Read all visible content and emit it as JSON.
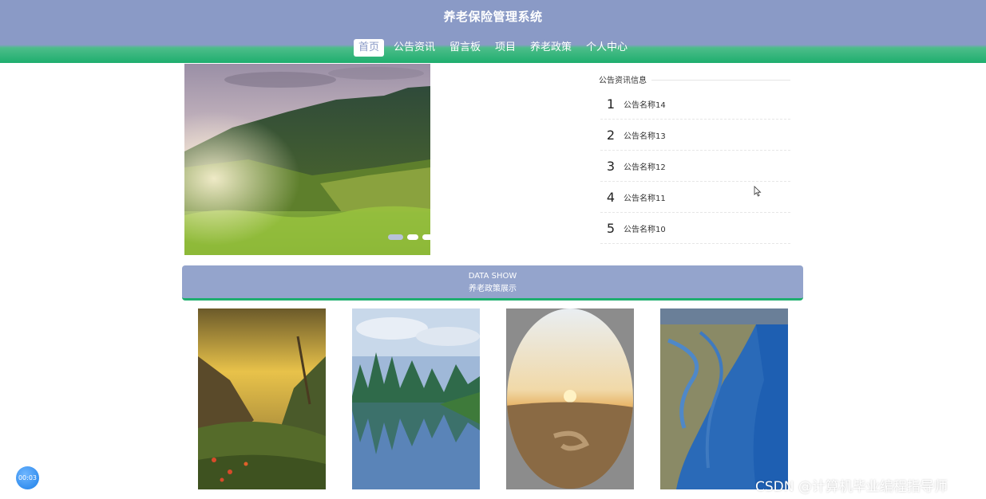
{
  "header": {
    "title": "养老保险管理系统",
    "nav": [
      "首页",
      "公告资讯",
      "留言板",
      "项目",
      "养老政策",
      "个人中心"
    ],
    "active_index": 0
  },
  "banner": {
    "slides": 3,
    "active_slide": 1
  },
  "notice": {
    "title": "公告资讯信息",
    "items": [
      {
        "num": "1",
        "name": "公告名称14"
      },
      {
        "num": "2",
        "name": "公告名称13"
      },
      {
        "num": "3",
        "name": "公告名称12"
      },
      {
        "num": "4",
        "name": "公告名称11"
      },
      {
        "num": "5",
        "name": "公告名称10"
      }
    ]
  },
  "data_show": {
    "en": "DATA SHOW",
    "cn": "养老政策展示"
  },
  "timer": "00:03",
  "watermark": "CSDN @计算机毕业编程指导师",
  "colors": {
    "header": "#8a9ac6",
    "accent_green": "#1eae6e",
    "data_show_bg": "#94a4cc"
  }
}
